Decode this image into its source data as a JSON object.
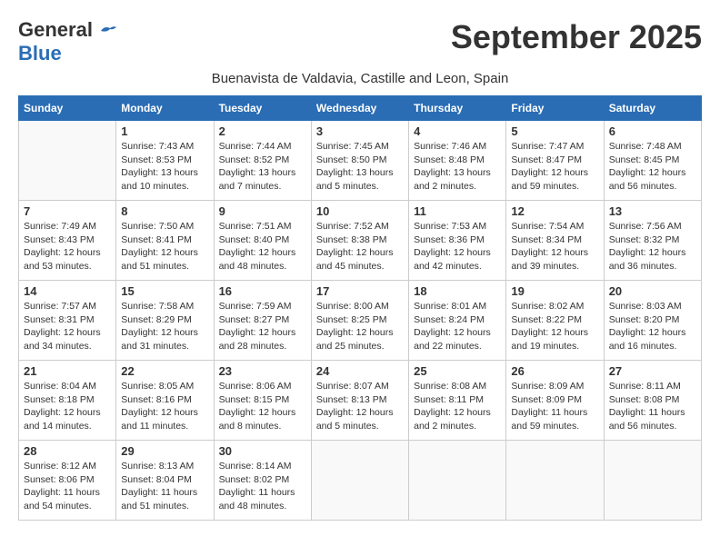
{
  "header": {
    "logo_general": "General",
    "logo_blue": "Blue",
    "month_title": "September 2025",
    "subtitle": "Buenavista de Valdavia, Castille and Leon, Spain"
  },
  "weekdays": [
    "Sunday",
    "Monday",
    "Tuesday",
    "Wednesday",
    "Thursday",
    "Friday",
    "Saturday"
  ],
  "weeks": [
    [
      {
        "day": "",
        "info": ""
      },
      {
        "day": "1",
        "info": "Sunrise: 7:43 AM\nSunset: 8:53 PM\nDaylight: 13 hours\nand 10 minutes."
      },
      {
        "day": "2",
        "info": "Sunrise: 7:44 AM\nSunset: 8:52 PM\nDaylight: 13 hours\nand 7 minutes."
      },
      {
        "day": "3",
        "info": "Sunrise: 7:45 AM\nSunset: 8:50 PM\nDaylight: 13 hours\nand 5 minutes."
      },
      {
        "day": "4",
        "info": "Sunrise: 7:46 AM\nSunset: 8:48 PM\nDaylight: 13 hours\nand 2 minutes."
      },
      {
        "day": "5",
        "info": "Sunrise: 7:47 AM\nSunset: 8:47 PM\nDaylight: 12 hours\nand 59 minutes."
      },
      {
        "day": "6",
        "info": "Sunrise: 7:48 AM\nSunset: 8:45 PM\nDaylight: 12 hours\nand 56 minutes."
      }
    ],
    [
      {
        "day": "7",
        "info": "Sunrise: 7:49 AM\nSunset: 8:43 PM\nDaylight: 12 hours\nand 53 minutes."
      },
      {
        "day": "8",
        "info": "Sunrise: 7:50 AM\nSunset: 8:41 PM\nDaylight: 12 hours\nand 51 minutes."
      },
      {
        "day": "9",
        "info": "Sunrise: 7:51 AM\nSunset: 8:40 PM\nDaylight: 12 hours\nand 48 minutes."
      },
      {
        "day": "10",
        "info": "Sunrise: 7:52 AM\nSunset: 8:38 PM\nDaylight: 12 hours\nand 45 minutes."
      },
      {
        "day": "11",
        "info": "Sunrise: 7:53 AM\nSunset: 8:36 PM\nDaylight: 12 hours\nand 42 minutes."
      },
      {
        "day": "12",
        "info": "Sunrise: 7:54 AM\nSunset: 8:34 PM\nDaylight: 12 hours\nand 39 minutes."
      },
      {
        "day": "13",
        "info": "Sunrise: 7:56 AM\nSunset: 8:32 PM\nDaylight: 12 hours\nand 36 minutes."
      }
    ],
    [
      {
        "day": "14",
        "info": "Sunrise: 7:57 AM\nSunset: 8:31 PM\nDaylight: 12 hours\nand 34 minutes."
      },
      {
        "day": "15",
        "info": "Sunrise: 7:58 AM\nSunset: 8:29 PM\nDaylight: 12 hours\nand 31 minutes."
      },
      {
        "day": "16",
        "info": "Sunrise: 7:59 AM\nSunset: 8:27 PM\nDaylight: 12 hours\nand 28 minutes."
      },
      {
        "day": "17",
        "info": "Sunrise: 8:00 AM\nSunset: 8:25 PM\nDaylight: 12 hours\nand 25 minutes."
      },
      {
        "day": "18",
        "info": "Sunrise: 8:01 AM\nSunset: 8:24 PM\nDaylight: 12 hours\nand 22 minutes."
      },
      {
        "day": "19",
        "info": "Sunrise: 8:02 AM\nSunset: 8:22 PM\nDaylight: 12 hours\nand 19 minutes."
      },
      {
        "day": "20",
        "info": "Sunrise: 8:03 AM\nSunset: 8:20 PM\nDaylight: 12 hours\nand 16 minutes."
      }
    ],
    [
      {
        "day": "21",
        "info": "Sunrise: 8:04 AM\nSunset: 8:18 PM\nDaylight: 12 hours\nand 14 minutes."
      },
      {
        "day": "22",
        "info": "Sunrise: 8:05 AM\nSunset: 8:16 PM\nDaylight: 12 hours\nand 11 minutes."
      },
      {
        "day": "23",
        "info": "Sunrise: 8:06 AM\nSunset: 8:15 PM\nDaylight: 12 hours\nand 8 minutes."
      },
      {
        "day": "24",
        "info": "Sunrise: 8:07 AM\nSunset: 8:13 PM\nDaylight: 12 hours\nand 5 minutes."
      },
      {
        "day": "25",
        "info": "Sunrise: 8:08 AM\nSunset: 8:11 PM\nDaylight: 12 hours\nand 2 minutes."
      },
      {
        "day": "26",
        "info": "Sunrise: 8:09 AM\nSunset: 8:09 PM\nDaylight: 11 hours\nand 59 minutes."
      },
      {
        "day": "27",
        "info": "Sunrise: 8:11 AM\nSunset: 8:08 PM\nDaylight: 11 hours\nand 56 minutes."
      }
    ],
    [
      {
        "day": "28",
        "info": "Sunrise: 8:12 AM\nSunset: 8:06 PM\nDaylight: 11 hours\nand 54 minutes."
      },
      {
        "day": "29",
        "info": "Sunrise: 8:13 AM\nSunset: 8:04 PM\nDaylight: 11 hours\nand 51 minutes."
      },
      {
        "day": "30",
        "info": "Sunrise: 8:14 AM\nSunset: 8:02 PM\nDaylight: 11 hours\nand 48 minutes."
      },
      {
        "day": "",
        "info": ""
      },
      {
        "day": "",
        "info": ""
      },
      {
        "day": "",
        "info": ""
      },
      {
        "day": "",
        "info": ""
      }
    ]
  ]
}
